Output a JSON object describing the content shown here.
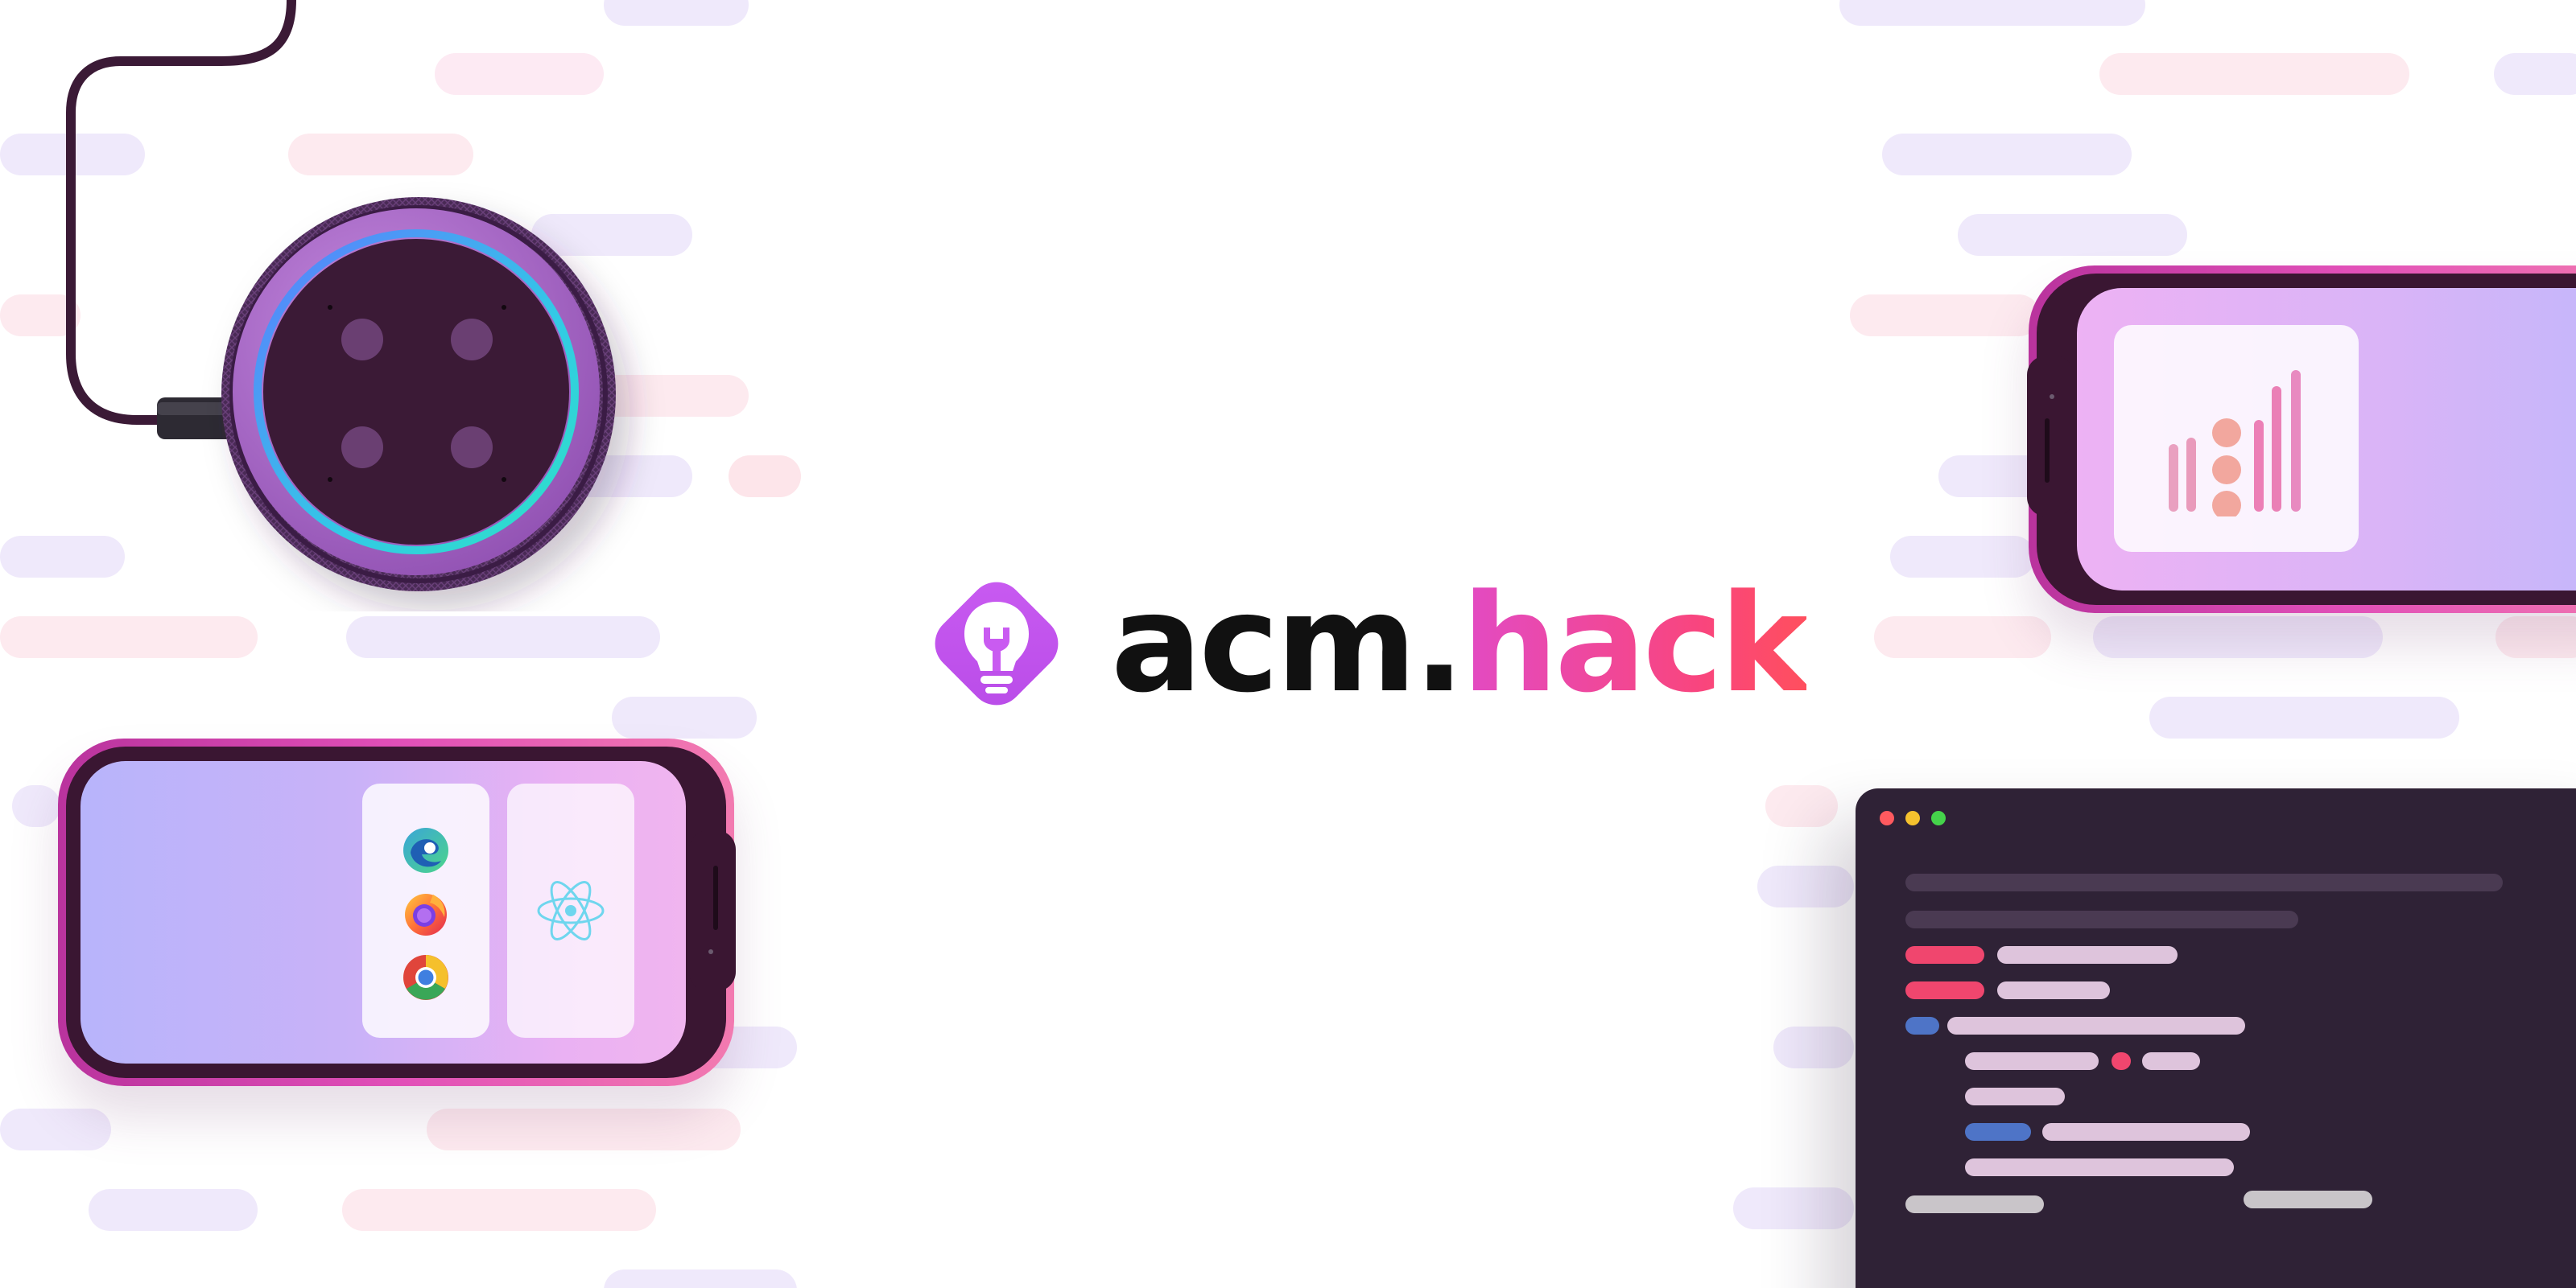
{
  "brand": {
    "name_prefix": "acm",
    "name_dot": ".",
    "name_suffix": "hack"
  },
  "icons": {
    "logo": "lightbulb-wrench-icon",
    "browsers": [
      "edge-icon",
      "firefox-icon",
      "chrome-icon"
    ],
    "framework": "react-icon",
    "window_controls": [
      "close-dot",
      "minimize-dot",
      "maximize-dot"
    ]
  },
  "colors": {
    "logo_purple": "#c85cf0",
    "brand_pink": "#e24bc4",
    "brand_red": "#ff4f5e",
    "code_background": "#2f2236"
  }
}
